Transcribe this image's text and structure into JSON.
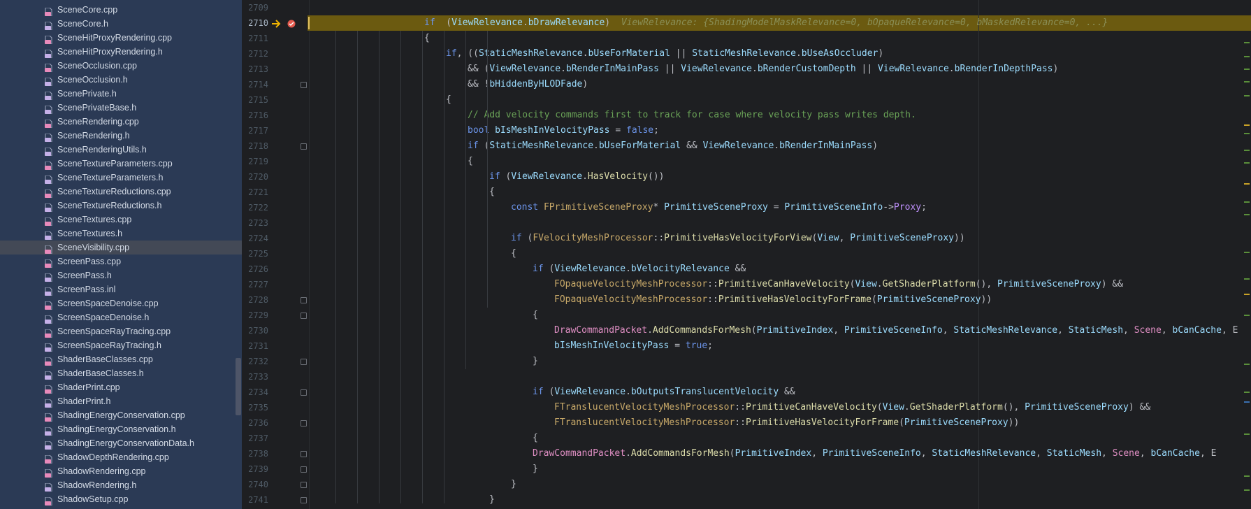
{
  "sidebar": {
    "selected_index": 17,
    "files": [
      "SceneCore.cpp",
      "SceneCore.h",
      "SceneHitProxyRendering.cpp",
      "SceneHitProxyRendering.h",
      "SceneOcclusion.cpp",
      "SceneOcclusion.h",
      "ScenePrivate.h",
      "ScenePrivateBase.h",
      "SceneRendering.cpp",
      "SceneRendering.h",
      "SceneRenderingUtils.h",
      "SceneTextureParameters.cpp",
      "SceneTextureParameters.h",
      "SceneTextureReductions.cpp",
      "SceneTextureReductions.h",
      "SceneTextures.cpp",
      "SceneTextures.h",
      "SceneVisibility.cpp",
      "ScreenPass.cpp",
      "ScreenPass.h",
      "ScreenPass.inl",
      "ScreenSpaceDenoise.cpp",
      "ScreenSpaceDenoise.h",
      "ScreenSpaceRayTracing.cpp",
      "ScreenSpaceRayTracing.h",
      "ShaderBaseClasses.cpp",
      "ShaderBaseClasses.h",
      "ShaderPrint.cpp",
      "ShaderPrint.h",
      "ShadingEnergyConservation.cpp",
      "ShadingEnergyConservation.h",
      "ShadingEnergyConservationData.h",
      "ShadowDepthRendering.cpp",
      "ShadowRendering.cpp",
      "ShadowRendering.h",
      "ShadowSetup.cpp"
    ]
  },
  "editor": {
    "current_line": 2710,
    "inline_hint": "ViewRelevance: {ShadingModelMaskRelevance=0, bOpaqueRelevance=0, bMaskedRelevance=0, ...}",
    "lines": [
      {
        "n": "2709",
        "segs": []
      },
      {
        "n": "2710",
        "segs": [
          [
            "k",
            "if"
          ],
          [
            "",
            "  ("
          ],
          [
            "v",
            "ViewRelevance"
          ],
          [
            "",
            "."
          ],
          [
            "v",
            "bDrawRelevance"
          ],
          [
            "",
            ")"
          ]
        ]
      },
      {
        "n": "2711",
        "segs": [
          [
            "",
            "{"
          ]
        ]
      },
      {
        "n": "2712",
        "segs": [
          [
            "k",
            "if"
          ],
          [
            "",
            ", (("
          ],
          [
            "v",
            "StaticMeshRelevance"
          ],
          [
            "",
            "."
          ],
          [
            "v",
            "bUseForMaterial"
          ],
          [
            "",
            " || "
          ],
          [
            "v",
            "StaticMeshRelevance"
          ],
          [
            "",
            "."
          ],
          [
            "v",
            "bUseAsOccluder"
          ],
          [
            "",
            ")"
          ]
        ]
      },
      {
        "n": "2713",
        "segs": [
          [
            "",
            "&& ("
          ],
          [
            "v",
            "ViewRelevance"
          ],
          [
            "",
            "."
          ],
          [
            "v",
            "bRenderInMainPass"
          ],
          [
            "",
            " || "
          ],
          [
            "v",
            "ViewRelevance"
          ],
          [
            "",
            "."
          ],
          [
            "v",
            "bRenderCustomDepth"
          ],
          [
            "",
            " || "
          ],
          [
            "v",
            "ViewRelevance"
          ],
          [
            "",
            "."
          ],
          [
            "v",
            "bRenderInDepthPass"
          ],
          [
            "",
            ")"
          ]
        ]
      },
      {
        "n": "2714",
        "segs": [
          [
            "",
            "&& !"
          ],
          [
            "v",
            "bHiddenByHLODFade"
          ],
          [
            "",
            ")"
          ]
        ]
      },
      {
        "n": "2715",
        "segs": [
          [
            "",
            "{"
          ]
        ]
      },
      {
        "n": "2716",
        "segs": [
          [
            "c",
            "// Add velocity commands first to track for case where velocity pass writes depth."
          ]
        ]
      },
      {
        "n": "2717",
        "segs": [
          [
            "k",
            "bool"
          ],
          [
            "",
            " "
          ],
          [
            "v",
            "bIsMeshInVelocityPass"
          ],
          [
            "",
            " = "
          ],
          [
            "k",
            "false"
          ],
          [
            "",
            ";"
          ]
        ]
      },
      {
        "n": "2718",
        "segs": [
          [
            "k",
            "if"
          ],
          [
            "",
            " ("
          ],
          [
            "v",
            "StaticMeshRelevance"
          ],
          [
            "",
            "."
          ],
          [
            "v",
            "bUseForMaterial"
          ],
          [
            "",
            " && "
          ],
          [
            "v",
            "ViewRelevance"
          ],
          [
            "",
            "."
          ],
          [
            "v",
            "bRenderInMainPass"
          ],
          [
            "",
            ")"
          ]
        ]
      },
      {
        "n": "2719",
        "segs": [
          [
            "",
            "{"
          ]
        ]
      },
      {
        "n": "2720",
        "segs": [
          [
            "k",
            "if"
          ],
          [
            "",
            " ("
          ],
          [
            "v",
            "ViewRelevance"
          ],
          [
            "",
            "."
          ],
          [
            "f",
            "HasVelocity"
          ],
          [
            "",
            "())"
          ]
        ]
      },
      {
        "n": "2721",
        "segs": [
          [
            "",
            "{"
          ]
        ]
      },
      {
        "n": "2722",
        "segs": [
          [
            "k",
            "const"
          ],
          [
            "",
            " "
          ],
          [
            "t",
            "FPrimitiveSceneProxy"
          ],
          [
            "",
            "* "
          ],
          [
            "v",
            "PrimitiveSceneProxy"
          ],
          [
            "",
            " = "
          ],
          [
            "v",
            "PrimitiveSceneInfo"
          ],
          [
            "",
            "->"
          ],
          [
            "p",
            "Proxy"
          ],
          [
            "",
            ";"
          ]
        ]
      },
      {
        "n": "2723",
        "segs": []
      },
      {
        "n": "2724",
        "segs": [
          [
            "k",
            "if"
          ],
          [
            "",
            " ("
          ],
          [
            "t",
            "FVelocityMeshProcessor"
          ],
          [
            "",
            "::"
          ],
          [
            "f",
            "PrimitiveHasVelocityForView"
          ],
          [
            "",
            "("
          ],
          [
            "v",
            "View"
          ],
          [
            "",
            ", "
          ],
          [
            "v",
            "PrimitiveSceneProxy"
          ],
          [
            "",
            "))"
          ]
        ]
      },
      {
        "n": "2725",
        "segs": [
          [
            "",
            "{"
          ]
        ]
      },
      {
        "n": "2726",
        "segs": [
          [
            "k",
            "if"
          ],
          [
            "",
            " ("
          ],
          [
            "v",
            "ViewRelevance"
          ],
          [
            "",
            "."
          ],
          [
            "v",
            "bVelocityRelevance"
          ],
          [
            "",
            " &&"
          ]
        ]
      },
      {
        "n": "2727",
        "segs": [
          [
            "t",
            "FOpaqueVelocityMeshProcessor"
          ],
          [
            "",
            "::"
          ],
          [
            "f",
            "PrimitiveCanHaveVelocity"
          ],
          [
            "",
            "("
          ],
          [
            "v",
            "View"
          ],
          [
            "",
            "."
          ],
          [
            "f",
            "GetShaderPlatform"
          ],
          [
            "",
            "(), "
          ],
          [
            "v",
            "PrimitiveSceneProxy"
          ],
          [
            "",
            ") &&"
          ]
        ]
      },
      {
        "n": "2728",
        "segs": [
          [
            "t",
            "FOpaqueVelocityMeshProcessor"
          ],
          [
            "",
            "::"
          ],
          [
            "f",
            "PrimitiveHasVelocityForFrame"
          ],
          [
            "",
            "("
          ],
          [
            "v",
            "PrimitiveSceneProxy"
          ],
          [
            "",
            "))"
          ]
        ]
      },
      {
        "n": "2729",
        "segs": [
          [
            "",
            "{"
          ]
        ]
      },
      {
        "n": "2730",
        "segs": [
          [
            "m",
            "DrawCommandPacket"
          ],
          [
            "",
            "."
          ],
          [
            "f",
            "AddCommandsForMesh"
          ],
          [
            "",
            "("
          ],
          [
            "v",
            "PrimitiveIndex"
          ],
          [
            "",
            ", "
          ],
          [
            "v",
            "PrimitiveSceneInfo"
          ],
          [
            "",
            ", "
          ],
          [
            "v",
            "StaticMeshRelevance"
          ],
          [
            "",
            ", "
          ],
          [
            "v",
            "StaticMesh"
          ],
          [
            "",
            ", "
          ],
          [
            "m",
            "Scene"
          ],
          [
            "",
            ", "
          ],
          [
            "v",
            "bCanCache"
          ],
          [
            "",
            ", E"
          ]
        ]
      },
      {
        "n": "2731",
        "segs": [
          [
            "v",
            "bIsMeshInVelocityPass"
          ],
          [
            "",
            " = "
          ],
          [
            "k",
            "true"
          ],
          [
            "",
            ";"
          ]
        ]
      },
      {
        "n": "2732",
        "segs": [
          [
            "",
            "}"
          ]
        ]
      },
      {
        "n": "2733",
        "segs": []
      },
      {
        "n": "2734",
        "segs": [
          [
            "k",
            "if"
          ],
          [
            "",
            " ("
          ],
          [
            "v",
            "ViewRelevance"
          ],
          [
            "",
            "."
          ],
          [
            "v",
            "bOutputsTranslucentVelocity"
          ],
          [
            "",
            " &&"
          ]
        ]
      },
      {
        "n": "2735",
        "segs": [
          [
            "t",
            "FTranslucentVelocityMeshProcessor"
          ],
          [
            "",
            "::"
          ],
          [
            "f",
            "PrimitiveCanHaveVelocity"
          ],
          [
            "",
            "("
          ],
          [
            "v",
            "View"
          ],
          [
            "",
            "."
          ],
          [
            "f",
            "GetShaderPlatform"
          ],
          [
            "",
            "(), "
          ],
          [
            "v",
            "PrimitiveSceneProxy"
          ],
          [
            "",
            ") &&"
          ]
        ]
      },
      {
        "n": "2736",
        "segs": [
          [
            "t",
            "FTranslucentVelocityMeshProcessor"
          ],
          [
            "",
            "::"
          ],
          [
            "f",
            "PrimitiveHasVelocityForFrame"
          ],
          [
            "",
            "("
          ],
          [
            "v",
            "PrimitiveSceneProxy"
          ],
          [
            "",
            "))"
          ]
        ]
      },
      {
        "n": "2737",
        "segs": [
          [
            "",
            "{"
          ]
        ]
      },
      {
        "n": "2738",
        "segs": [
          [
            "m",
            "DrawCommandPacket"
          ],
          [
            "",
            "."
          ],
          [
            "f",
            "AddCommandsForMesh"
          ],
          [
            "",
            "("
          ],
          [
            "v",
            "PrimitiveIndex"
          ],
          [
            "",
            ", "
          ],
          [
            "v",
            "PrimitiveSceneInfo"
          ],
          [
            "",
            ", "
          ],
          [
            "v",
            "StaticMeshRelevance"
          ],
          [
            "",
            ", "
          ],
          [
            "v",
            "StaticMesh"
          ],
          [
            "",
            ", "
          ],
          [
            "m",
            "Scene"
          ],
          [
            "",
            ", "
          ],
          [
            "v",
            "bCanCache"
          ],
          [
            "",
            ", E"
          ]
        ]
      },
      {
        "n": "2739",
        "segs": [
          [
            "",
            "}"
          ]
        ]
      },
      {
        "n": "2740",
        "segs": [
          [
            "",
            "}"
          ]
        ]
      },
      {
        "n": "2741",
        "segs": [
          [
            "",
            "}"
          ]
        ]
      }
    ]
  },
  "colors": {
    "accent": "#6c95eb",
    "highlight": "#6b5a10",
    "sidebar": "#2b3a55"
  }
}
